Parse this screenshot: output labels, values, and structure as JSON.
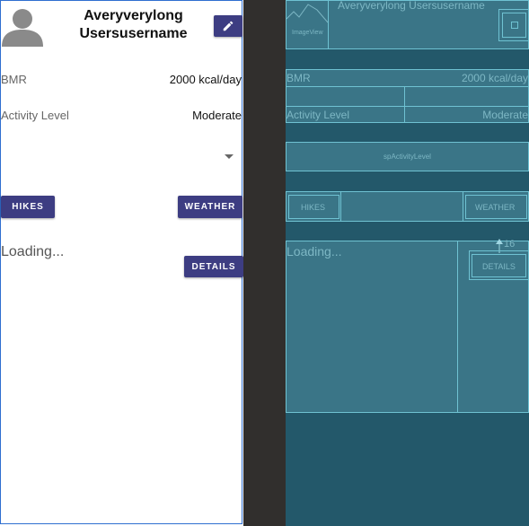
{
  "profile": {
    "username": "Averyverylong Usersusername",
    "edit_icon": "pencil-icon",
    "avatar_icon": "person-icon"
  },
  "stats": {
    "bmr_label": "BMR",
    "bmr_value": "2000 kcal/day",
    "activity_label": "Activity Level",
    "activity_value": "Moderate"
  },
  "spinner": {
    "icon": "dropdown-arrow-icon"
  },
  "buttons": {
    "hikes": "HIKES",
    "weather": "WEATHER",
    "details": "DETAILS"
  },
  "content": {
    "loading_text": "Loading..."
  },
  "blueprint": {
    "image_view_label": "ImageView",
    "username": "Averyverylong Usersusername",
    "bmr_label": "BMR",
    "bmr_value": "2000 kcal/day",
    "activity_label": "Activity Level",
    "activity_value": "Moderate",
    "spinner_label": "spActivityLevel",
    "hikes": "HIKES",
    "weather": "WEATHER",
    "loading_text": "Loading...",
    "details": "DETAILS",
    "constraint_label": "16"
  },
  "colors": {
    "button": "#3d3d82",
    "blueprint_bg": "#23586a",
    "blueprint_line": "#6fc2d2"
  }
}
